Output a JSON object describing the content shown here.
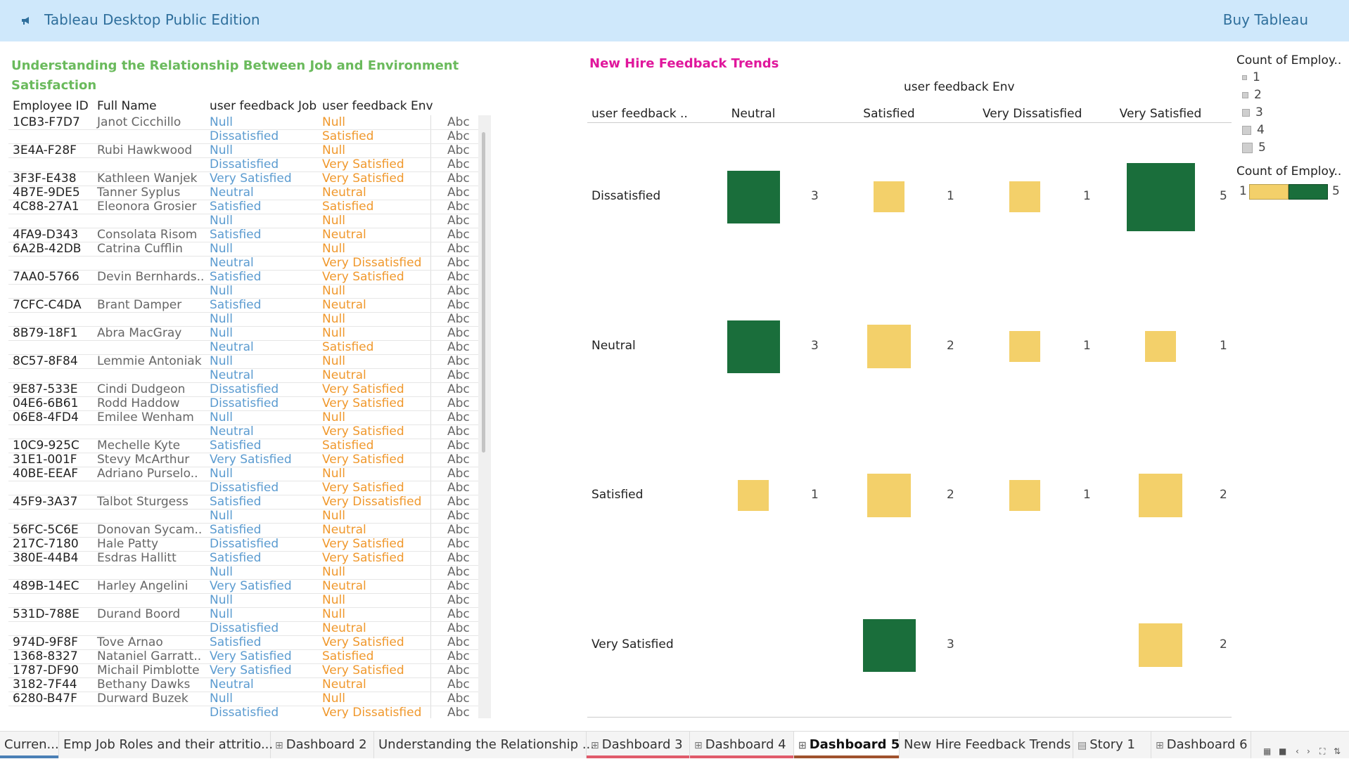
{
  "app": {
    "title": "Tableau Desktop Public Edition",
    "buy_label": "Buy Tableau",
    "logo_icon": "megaphone-icon"
  },
  "left_sheet": {
    "title": "Understanding the Relationship Between Job and Environment Satisfaction",
    "headers": {
      "id": "Employee ID",
      "name": "Full Name",
      "job": "user feedback Job",
      "env": "user feedback Env"
    },
    "rows": [
      {
        "id": "1CB3-F7D7",
        "name": "Janot Cicchillo",
        "job": "Null",
        "env": "Null",
        "abc": "Abc"
      },
      {
        "id": "",
        "name": "",
        "job": "Dissatisfied",
        "env": "Satisfied",
        "abc": "Abc"
      },
      {
        "id": "3E4A-F28F",
        "name": "Rubi Hawkwood",
        "job": "Null",
        "env": "Null",
        "abc": "Abc"
      },
      {
        "id": "",
        "name": "",
        "job": "Dissatisfied",
        "env": "Very Satisfied",
        "abc": "Abc"
      },
      {
        "id": "3F3F-E438",
        "name": "Kathleen Wanjek",
        "job": "Very Satisfied",
        "env": "Very Satisfied",
        "abc": "Abc"
      },
      {
        "id": "4B7E-9DE5",
        "name": "Tanner Syplus",
        "job": "Neutral",
        "env": "Neutral",
        "abc": "Abc"
      },
      {
        "id": "4C88-27A1",
        "name": "Eleonora Grosier",
        "job": "Satisfied",
        "env": "Satisfied",
        "abc": "Abc"
      },
      {
        "id": "",
        "name": "",
        "job": "Null",
        "env": "Null",
        "abc": "Abc"
      },
      {
        "id": "4FA9-D343",
        "name": "Consolata Risom",
        "job": "Satisfied",
        "env": "Neutral",
        "abc": "Abc"
      },
      {
        "id": "6A2B-42DB",
        "name": "Catrina Cufflin",
        "job": "Null",
        "env": "Null",
        "abc": "Abc"
      },
      {
        "id": "",
        "name": "",
        "job": "Neutral",
        "env": "Very Dissatisfied",
        "abc": "Abc"
      },
      {
        "id": "7AA0-5766",
        "name": "Devin Bernhards..",
        "job": "Satisfied",
        "env": "Very Satisfied",
        "abc": "Abc"
      },
      {
        "id": "",
        "name": "",
        "job": "Null",
        "env": "Null",
        "abc": "Abc"
      },
      {
        "id": "7CFC-C4DA",
        "name": "Brant Damper",
        "job": "Satisfied",
        "env": "Neutral",
        "abc": "Abc"
      },
      {
        "id": "",
        "name": "",
        "job": "Null",
        "env": "Null",
        "abc": "Abc"
      },
      {
        "id": "8B79-18F1",
        "name": "Abra MacGray",
        "job": "Null",
        "env": "Null",
        "abc": "Abc"
      },
      {
        "id": "",
        "name": "",
        "job": "Neutral",
        "env": "Satisfied",
        "abc": "Abc"
      },
      {
        "id": "8C57-8F84",
        "name": "Lemmie Antoniak",
        "job": "Null",
        "env": "Null",
        "abc": "Abc"
      },
      {
        "id": "",
        "name": "",
        "job": "Neutral",
        "env": "Neutral",
        "abc": "Abc"
      },
      {
        "id": "9E87-533E",
        "name": "Cindi Dudgeon",
        "job": "Dissatisfied",
        "env": "Very Satisfied",
        "abc": "Abc"
      },
      {
        "id": "04E6-6B61",
        "name": "Rodd Haddow",
        "job": "Dissatisfied",
        "env": "Very Satisfied",
        "abc": "Abc"
      },
      {
        "id": "06E8-4FD4",
        "name": "Emilee Wenham",
        "job": "Null",
        "env": "Null",
        "abc": "Abc"
      },
      {
        "id": "",
        "name": "",
        "job": "Neutral",
        "env": "Very Satisfied",
        "abc": "Abc"
      },
      {
        "id": "10C9-925C",
        "name": "Mechelle Kyte",
        "job": "Satisfied",
        "env": "Satisfied",
        "abc": "Abc"
      },
      {
        "id": "31E1-001F",
        "name": "Stevy McArthur",
        "job": "Very Satisfied",
        "env": "Very Satisfied",
        "abc": "Abc"
      },
      {
        "id": "40BE-EEAF",
        "name": "Adriano Purselo..",
        "job": "Null",
        "env": "Null",
        "abc": "Abc"
      },
      {
        "id": "",
        "name": "",
        "job": "Dissatisfied",
        "env": "Very Satisfied",
        "abc": "Abc"
      },
      {
        "id": "45F9-3A37",
        "name": "Talbot Sturgess",
        "job": "Satisfied",
        "env": "Very Dissatisfied",
        "abc": "Abc"
      },
      {
        "id": "",
        "name": "",
        "job": "Null",
        "env": "Null",
        "abc": "Abc"
      },
      {
        "id": "56FC-5C6E",
        "name": "Donovan Sycam..",
        "job": "Satisfied",
        "env": "Neutral",
        "abc": "Abc"
      },
      {
        "id": "217C-7180",
        "name": "Hale Patty",
        "job": "Dissatisfied",
        "env": "Very Satisfied",
        "abc": "Abc"
      },
      {
        "id": "380E-44B4",
        "name": "Esdras Hallitt",
        "job": "Satisfied",
        "env": "Very Satisfied",
        "abc": "Abc"
      },
      {
        "id": "",
        "name": "",
        "job": "Null",
        "env": "Null",
        "abc": "Abc"
      },
      {
        "id": "489B-14EC",
        "name": "Harley Angelini",
        "job": "Very Satisfied",
        "env": "Neutral",
        "abc": "Abc"
      },
      {
        "id": "",
        "name": "",
        "job": "Null",
        "env": "Null",
        "abc": "Abc"
      },
      {
        "id": "531D-788E",
        "name": "Durand Boord",
        "job": "Null",
        "env": "Null",
        "abc": "Abc"
      },
      {
        "id": "",
        "name": "",
        "job": "Dissatisfied",
        "env": "Neutral",
        "abc": "Abc"
      },
      {
        "id": "974D-9F8F",
        "name": "Tove Arnao",
        "job": "Satisfied",
        "env": "Very Satisfied",
        "abc": "Abc"
      },
      {
        "id": "1368-8327",
        "name": "Nataniel Garratt..",
        "job": "Very Satisfied",
        "env": "Satisfied",
        "abc": "Abc"
      },
      {
        "id": "1787-DF90",
        "name": "Michail Pimblotte",
        "job": "Very Satisfied",
        "env": "Very Satisfied",
        "abc": "Abc"
      },
      {
        "id": "3182-7F44",
        "name": "Bethany Dawks",
        "job": "Neutral",
        "env": "Neutral",
        "abc": "Abc"
      },
      {
        "id": "6280-B47F",
        "name": "Durward Buzek",
        "job": "Null",
        "env": "Null",
        "abc": "Abc"
      },
      {
        "id": "",
        "name": "",
        "job": "Dissatisfied",
        "env": "Very Dissatisfied",
        "abc": "Abc"
      }
    ]
  },
  "right_sheet": {
    "title": "New Hire Feedback Trends",
    "column_header": "user feedback Env",
    "row_header": "user feedback ..",
    "columns": [
      "Neutral",
      "Satisfied",
      "Very Dissatisfied",
      "Very Satisfied"
    ],
    "rows": [
      "Dissatisfied",
      "Neutral",
      "Satisfied",
      "Very Satisfied"
    ]
  },
  "chart_data": {
    "type": "heatmap",
    "title": "New Hire Feedback Trends",
    "xlabel": "user feedback Env",
    "ylabel": "user feedback ..",
    "x_categories": [
      "Neutral",
      "Satisfied",
      "Very Dissatisfied",
      "Very Satisfied"
    ],
    "y_categories": [
      "Dissatisfied",
      "Neutral",
      "Satisfied",
      "Very Satisfied"
    ],
    "values": [
      [
        3,
        1,
        1,
        5
      ],
      [
        3,
        2,
        1,
        1
      ],
      [
        1,
        2,
        1,
        2
      ],
      [
        null,
        3,
        null,
        2
      ]
    ],
    "color_scale": {
      "low": "#f3d06a",
      "high": "#1a6e3b",
      "threshold": 3
    }
  },
  "legend": {
    "size_title": "Count of Employ..",
    "size_items": [
      "1",
      "2",
      "3",
      "4",
      "5"
    ],
    "color_title": "Count of Employ..",
    "color_min": "1",
    "color_max": "5"
  },
  "tabs": [
    {
      "label": "Curren...",
      "icon": ""
    },
    {
      "label": "Emp Job Roles and their attritio...",
      "icon": ""
    },
    {
      "label": "Dashboard 2",
      "icon": "dashboard-icon"
    },
    {
      "label": "Understanding the Relationship ...",
      "icon": ""
    },
    {
      "label": "Dashboard 3",
      "icon": "dashboard-icon"
    },
    {
      "label": "Dashboard 4",
      "icon": "dashboard-icon"
    },
    {
      "label": "Dashboard 5",
      "icon": "dashboard-icon"
    },
    {
      "label": "New Hire Feedback Trends",
      "icon": ""
    },
    {
      "label": "Story 1",
      "icon": "story-icon"
    },
    {
      "label": "Dashboard 6",
      "icon": "dashboard-icon"
    }
  ],
  "active_tab": "Dashboard 5"
}
